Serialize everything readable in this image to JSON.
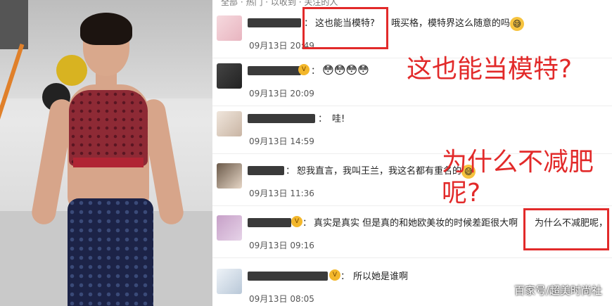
{
  "photo": {
    "subject": "model-runway-photo"
  },
  "panel": {
    "tabs_cut": "全部 · 热门 · 以收到 · 关注的人"
  },
  "comments": [
    {
      "text": "这也能当模特?",
      "text2": "哦买格，模特界这么随意的吗",
      "emoji": "😅",
      "time": "09月13日 20:49"
    },
    {
      "emoji": "😳😳😳😳",
      "time": "09月13日 20:09"
    },
    {
      "text": "哇!",
      "time": "09月13日 14:59"
    },
    {
      "text": "恕我直言，我叫王兰，我这名都有重名的",
      "emoji": "😅",
      "time": "09月13日 11:36"
    },
    {
      "text": "真实是真实 但是真的和她欧美妆的时候差距很大啊",
      "text2": "为什么不减肥呢，",
      "time": "09月13日 09:16"
    },
    {
      "text": "所以她是谁啊",
      "time": "09月13日 08:05"
    }
  ],
  "overlay": {
    "caption1": "这也能当模特?",
    "caption2_line1": "为什么不减肥",
    "caption2_line2": "呢?",
    "watermark": "百家号/超美时尚社"
  },
  "colors": {
    "highlight": "#e22a2a",
    "vip": "#f3b72b"
  }
}
